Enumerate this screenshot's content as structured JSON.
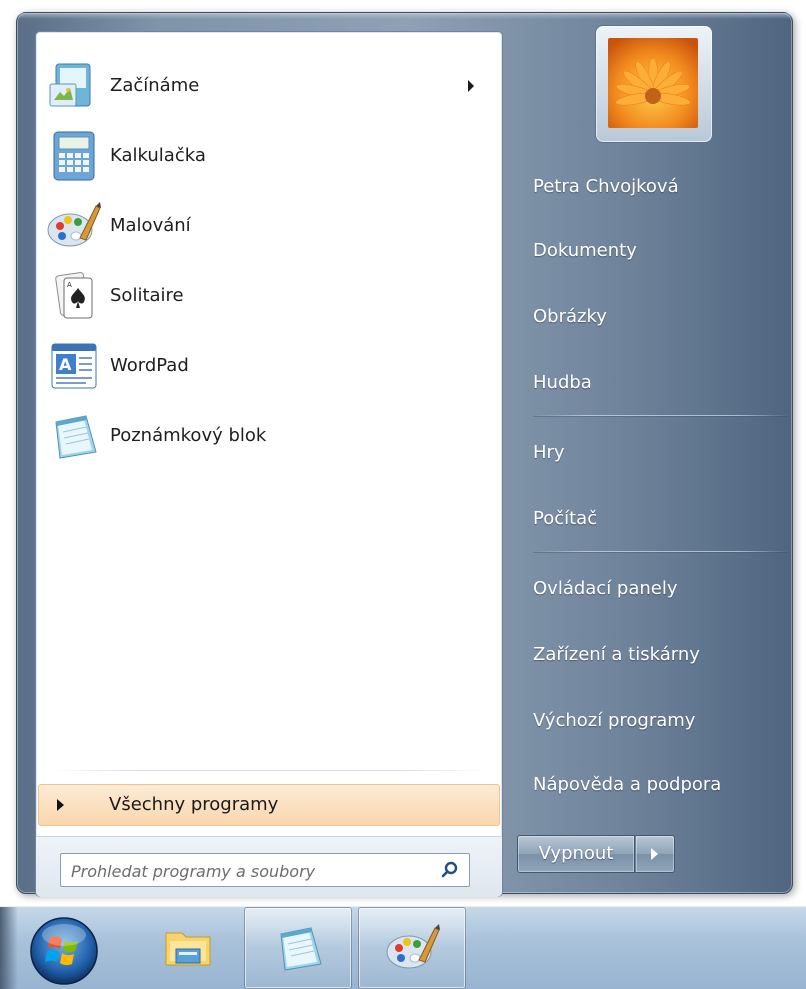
{
  "start_menu": {
    "programs": [
      {
        "label": "Začínáme",
        "icon": "getting-started-icon",
        "has_submenu": true
      },
      {
        "label": "Kalkulačka",
        "icon": "calculator-icon",
        "has_submenu": false
      },
      {
        "label": "Malování",
        "icon": "paint-icon",
        "has_submenu": false
      },
      {
        "label": "Solitaire",
        "icon": "solitaire-icon",
        "has_submenu": false
      },
      {
        "label": "WordPad",
        "icon": "wordpad-icon",
        "has_submenu": false
      },
      {
        "label": "Poznámkový blok",
        "icon": "notepad-icon",
        "has_submenu": false
      }
    ],
    "all_programs_label": "Všechny programy",
    "search": {
      "placeholder": "Prohledat programy a soubory",
      "value": ""
    },
    "user": {
      "name": "Petra Chvojková",
      "picture": "flower-icon"
    },
    "right_items": {
      "documents": "Dokumenty",
      "pictures": "Obrázky",
      "music": "Hudba",
      "games": "Hry",
      "computer": "Počítač",
      "control_panel": "Ovládací panely",
      "devices_printers": "Zařízení a tiskárny",
      "default_programs": "Výchozí programy",
      "help_support": "Nápověda a podpora"
    },
    "shutdown_label": "Vypnout"
  },
  "taskbar": {
    "items": [
      {
        "icon": "windows-start-orb-icon",
        "state": "button"
      },
      {
        "icon": "windows-explorer-icon",
        "state": "pinned"
      },
      {
        "icon": "notepad-icon",
        "state": "running"
      },
      {
        "icon": "paint-icon",
        "state": "running"
      }
    ]
  },
  "colors": {
    "menu_frame": "#7f93a9",
    "all_programs_highlight": "#f9d7ae",
    "taskbar": "#a9c2da"
  }
}
